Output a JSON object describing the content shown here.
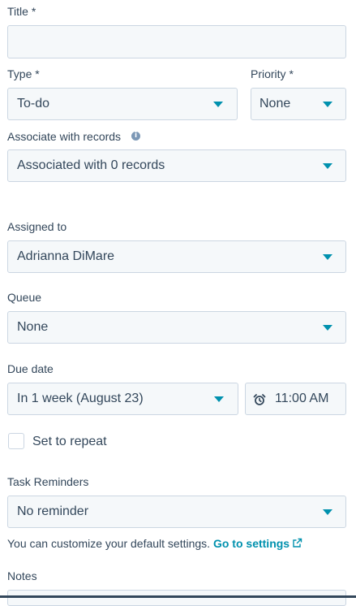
{
  "form": {
    "title": {
      "label": "Title *",
      "value": ""
    },
    "type": {
      "label": "Type *",
      "value": "To-do"
    },
    "priority": {
      "label": "Priority *",
      "value": "None"
    },
    "associate": {
      "label": "Associate with records",
      "value": "Associated with 0 records"
    },
    "assigned_to": {
      "label": "Assigned to",
      "value": "Adrianna DiMare"
    },
    "queue": {
      "label": "Queue",
      "value": "None"
    },
    "due_date": {
      "label": "Due date",
      "date_value": "In 1 week (August 23)",
      "time_value": "11:00 AM"
    },
    "repeat": {
      "label": "Set to repeat",
      "checked": false
    },
    "reminders": {
      "label": "Task Reminders",
      "value": "No reminder"
    },
    "settings_hint": {
      "text": "You can customize your default settings.",
      "link": "Go to settings"
    },
    "notes": {
      "label": "Notes"
    }
  },
  "colors": {
    "accent": "#0091ae",
    "text": "#33475b",
    "field_bg": "#f5f8fa",
    "field_border": "#cbd6e2"
  },
  "icons": [
    "info-icon",
    "chevron-down-icon",
    "alarm-clock-icon",
    "external-link-icon"
  ]
}
